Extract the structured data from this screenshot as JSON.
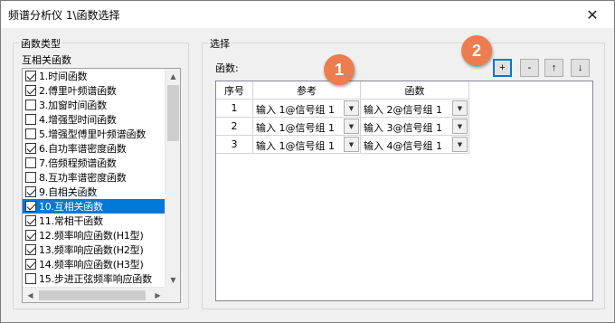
{
  "window": {
    "title": "频谱分析仪 1\\函数选择",
    "close_glyph": "✕"
  },
  "left_group": {
    "label": "函数类型",
    "list_label": "互相关函数",
    "items": [
      {
        "label": "1.时间函数",
        "checked": true,
        "selected": false
      },
      {
        "label": "2.傅里叶频谱函数",
        "checked": true,
        "selected": false
      },
      {
        "label": "3.加窗时间函数",
        "checked": false,
        "selected": false
      },
      {
        "label": "4.增强型时间函数",
        "checked": false,
        "selected": false
      },
      {
        "label": "5.增强型傅里叶频谱函数",
        "checked": false,
        "selected": false
      },
      {
        "label": "6.自功率谱密度函数",
        "checked": true,
        "selected": false
      },
      {
        "label": "7.倍频程频谱函数",
        "checked": false,
        "selected": false
      },
      {
        "label": "8.互功率谱密度函数",
        "checked": false,
        "selected": false
      },
      {
        "label": "9.自相关函数",
        "checked": true,
        "selected": false
      },
      {
        "label": "10.互相关函数",
        "checked": true,
        "selected": true
      },
      {
        "label": "11.常相干函数",
        "checked": true,
        "selected": false
      },
      {
        "label": "12.频率响应函数(H1型)",
        "checked": true,
        "selected": false
      },
      {
        "label": "13.频率响应函数(H2型)",
        "checked": true,
        "selected": false
      },
      {
        "label": "14.频率响应函数(H3型)",
        "checked": true,
        "selected": false
      },
      {
        "label": "15.步进正弦频率响应函数",
        "checked": false,
        "selected": false
      }
    ],
    "scroll": {
      "up": "▲",
      "down": "▼",
      "left": "◀",
      "right": "▶"
    }
  },
  "right_group": {
    "label": "选择",
    "function_label": "函数:",
    "toolbar": {
      "add": "+",
      "remove": "-",
      "move_up": "↑",
      "move_down": "↓"
    },
    "table": {
      "headers": {
        "index": "序号",
        "reference": "参考",
        "function": "函数"
      },
      "rows": [
        {
          "index": "1",
          "reference": "输入 1@信号组 1",
          "function": "输入 2@信号组 1"
        },
        {
          "index": "2",
          "reference": "输入 1@信号组 1",
          "function": "输入 3@信号组 1"
        },
        {
          "index": "3",
          "reference": "输入 1@信号组 1",
          "function": "输入 4@信号组 1"
        }
      ],
      "dropdown_glyph": "▼"
    }
  },
  "annotations": {
    "badge_1": "1",
    "badge_2": "2"
  },
  "colors": {
    "selection": "#0078d7",
    "badge": "#ec7d4e"
  }
}
